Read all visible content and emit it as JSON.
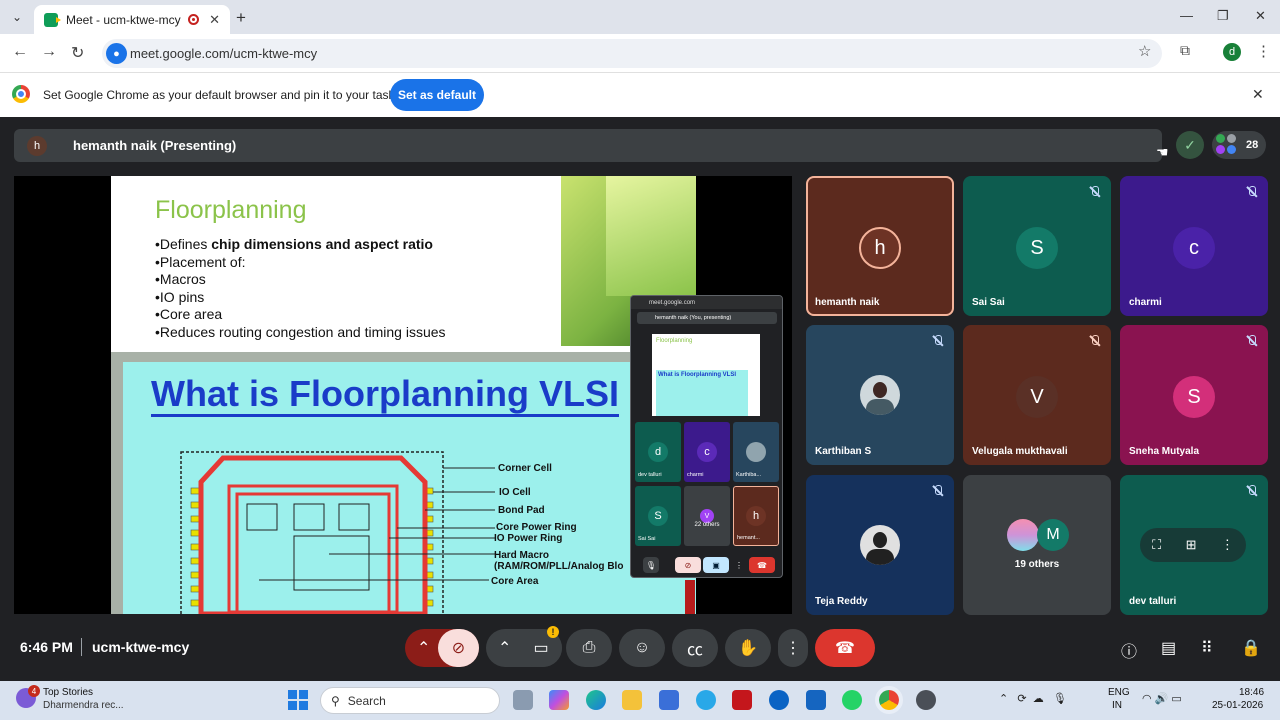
{
  "browser": {
    "tab_title": "Meet - ucm-ktwe-mcy",
    "url": "meet.google.com/ucm-ktwe-mcy",
    "profile_initial": "d",
    "infobar_text": "Set Google Chrome as your default browser and pin it to your taskbar",
    "infobar_button": "Set as default"
  },
  "meet": {
    "presenter_initial": "h",
    "presenter_label": "hemanth naik (Presenting)",
    "participant_count": "28",
    "time": "6:46 PM",
    "meeting_code": "ucm-ktwe-mcy",
    "slide": {
      "title": "Floorplanning",
      "bullet1_prefix": "•Defines ",
      "bullet1_bold": "chip dimensions and aspect ratio",
      "bullets": [
        "•Placement of:",
        "•Macros",
        "•IO pins",
        "•Core area",
        "•Reduces routing congestion and timing issues"
      ],
      "heading": "What is Floorplanning VLSI",
      "labels": {
        "corner": "Corner Cell",
        "io": "IO Cell",
        "bond": "Bond Pad",
        "core_ring": "Core Power Ring",
        "io_ring": "IO Power Ring",
        "macro1": "Hard Macro",
        "macro2": "(RAM/ROM/PLL/Analog Blo",
        "core": "Core Area"
      }
    },
    "pip": {
      "url": "meet.google.com",
      "presenting": "hemanth naik (You, presenting)",
      "mini_title": "Floorplanning",
      "mini_heading": "What is Floorplanning VLSI",
      "tiles": [
        {
          "initial": "d",
          "name": "dev talluri"
        },
        {
          "initial": "c",
          "name": "charmi"
        },
        {
          "initial": "",
          "name": "Karthiba..."
        },
        {
          "initial": "S",
          "name": "Sai Sai"
        },
        {
          "initial": "",
          "name": "22 others"
        },
        {
          "initial": "h",
          "name": "hemant..."
        }
      ],
      "others_initial": "V"
    },
    "tiles": [
      {
        "initial": "h",
        "name": "hemanth naik"
      },
      {
        "initial": "S",
        "name": "Sai Sai"
      },
      {
        "initial": "c",
        "name": "charmi"
      },
      {
        "initial": "",
        "name": "Karthiban S"
      },
      {
        "initial": "V",
        "name": "Velugala mukthavali"
      },
      {
        "initial": "S",
        "name": "Sneha Mutyala"
      },
      {
        "initial": "",
        "name": "Teja Reddy"
      },
      {
        "initial": "M",
        "name": "19 others"
      },
      {
        "initial": "",
        "name": "dev talluri"
      }
    ]
  },
  "taskbar": {
    "news_badge": "4",
    "news_title": "Top Stories",
    "news_sub": "Dharmendra rec...",
    "search": "Search",
    "lang1": "ENG",
    "lang2": "IN",
    "time": "18:46",
    "date": "25-01-2026"
  },
  "colors": {
    "meet_bg": "#202124",
    "accent": "#1a73e8",
    "end_call": "#dc362e"
  }
}
